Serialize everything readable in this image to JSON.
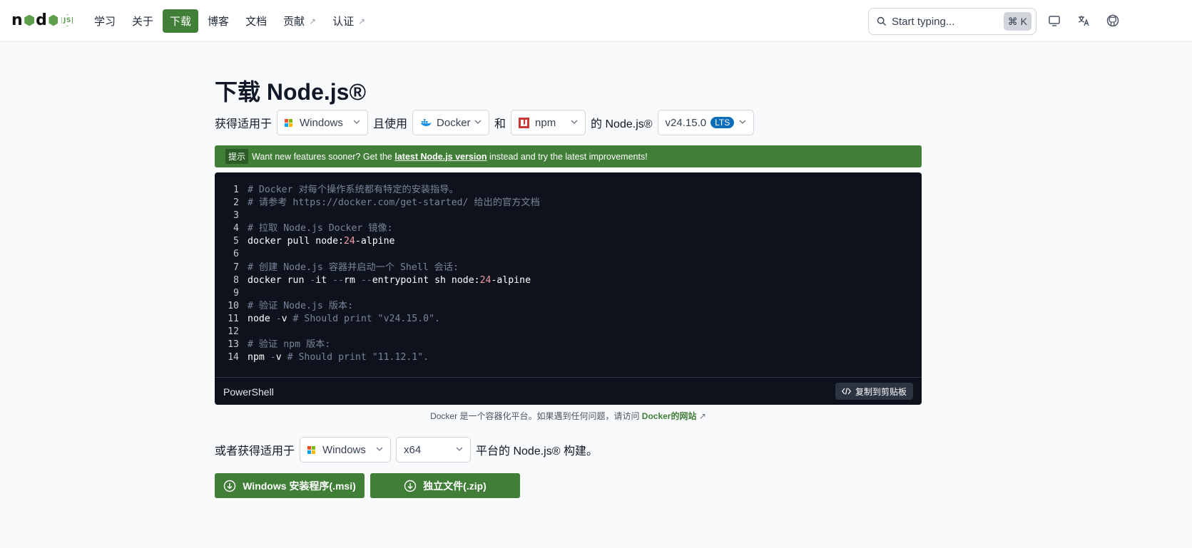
{
  "header": {
    "logo_text": "node",
    "logo_badge": "JS",
    "nav": [
      {
        "label": "学习",
        "active": false,
        "external": false
      },
      {
        "label": "关于",
        "active": false,
        "external": false
      },
      {
        "label": "下载",
        "active": true,
        "external": false
      },
      {
        "label": "博客",
        "active": false,
        "external": false
      },
      {
        "label": "文档",
        "active": false,
        "external": false
      },
      {
        "label": "贡献",
        "active": false,
        "external": true
      },
      {
        "label": "认证",
        "active": false,
        "external": true
      }
    ],
    "external_glyph": "↗",
    "search_placeholder": "Start typing...",
    "search_shortcut": "⌘ K",
    "icons": [
      "monitor-icon",
      "translate-icon",
      "github-icon"
    ]
  },
  "page": {
    "title": "下载 Node.js®",
    "get_for": "获得适用于",
    "and_use": "且使用",
    "and": "和",
    "of_node": "的 Node.js®",
    "os_select": "Windows",
    "tool_select": "Docker",
    "pm_select": "npm",
    "version_select": "v24.15.0",
    "version_badge": "LTS"
  },
  "banner": {
    "tag": "提示",
    "before": "Want new features sooner? Get the ",
    "link": "latest Node.js version",
    "after": " instead and try the latest improvements!"
  },
  "code": {
    "language": "PowerShell",
    "copy_label": "复制到剪贴板",
    "lines": [
      {
        "n": "1",
        "parts": [
          {
            "t": "# Docker 对每个操作系统都有特定的安装指导。",
            "c": "cm"
          }
        ]
      },
      {
        "n": "2",
        "parts": [
          {
            "t": "# 请参考 https://docker.com/get-started/ 给出的官方文档",
            "c": "cm"
          }
        ]
      },
      {
        "n": "3",
        "parts": []
      },
      {
        "n": "4",
        "parts": [
          {
            "t": "# 拉取 Node.js Docker 镜像:",
            "c": "cm"
          }
        ]
      },
      {
        "n": "5",
        "parts": [
          {
            "t": "docker pull node:",
            "c": ""
          },
          {
            "t": "24",
            "c": "nm"
          },
          {
            "t": "-alpine",
            "c": ""
          }
        ]
      },
      {
        "n": "6",
        "parts": []
      },
      {
        "n": "7",
        "parts": [
          {
            "t": "# 创建 Node.js 容器并启动一个 Shell 会话:",
            "c": "cm"
          }
        ]
      },
      {
        "n": "8",
        "parts": [
          {
            "t": "docker run ",
            "c": ""
          },
          {
            "t": "-",
            "c": "cm"
          },
          {
            "t": "it ",
            "c": ""
          },
          {
            "t": "--",
            "c": "cm"
          },
          {
            "t": "rm ",
            "c": ""
          },
          {
            "t": "--",
            "c": "cm"
          },
          {
            "t": "entrypoint sh node:",
            "c": ""
          },
          {
            "t": "24",
            "c": "nm"
          },
          {
            "t": "-alpine",
            "c": ""
          }
        ]
      },
      {
        "n": "9",
        "parts": []
      },
      {
        "n": "10",
        "parts": [
          {
            "t": "# 验证 Node.js 版本:",
            "c": "cm"
          }
        ]
      },
      {
        "n": "11",
        "parts": [
          {
            "t": "node ",
            "c": ""
          },
          {
            "t": "-",
            "c": "cm"
          },
          {
            "t": "v ",
            "c": ""
          },
          {
            "t": "# Should print \"v24.15.0\".",
            "c": "cm"
          }
        ]
      },
      {
        "n": "12",
        "parts": []
      },
      {
        "n": "13",
        "parts": [
          {
            "t": "# 验证 npm 版本:",
            "c": "cm"
          }
        ]
      },
      {
        "n": "14",
        "parts": [
          {
            "t": "npm ",
            "c": ""
          },
          {
            "t": "-",
            "c": "cm"
          },
          {
            "t": "v ",
            "c": ""
          },
          {
            "t": "# Should print \"11.12.1\".",
            "c": "cm"
          }
        ]
      }
    ]
  },
  "note": {
    "text": "Docker 是一个容器化平台。如果遇到任何问题，请访问 ",
    "link": "Docker的网站",
    "glyph": "↗"
  },
  "alt": {
    "prefix": "或者获得适用于",
    "os_select": "Windows",
    "arch_select": "x64",
    "suffix": "平台的 Node.js® 构建。"
  },
  "buttons": {
    "msi": "Windows 安装程序(.msi)",
    "zip": "独立文件(.zip)"
  },
  "colors": {
    "brand_green": "#417e38",
    "code_bg": "#0d121c",
    "lts_blue": "#0c6eb9"
  }
}
